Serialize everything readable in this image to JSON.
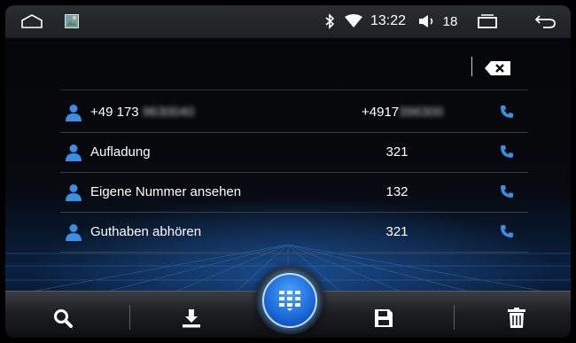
{
  "status_bar": {
    "home_icon": "home-outline-icon",
    "app_icon": "gallery-app-icon",
    "bluetooth_icon": "bluetooth-icon",
    "wifi_icon": "wifi-icon",
    "time": "13:22",
    "volume_icon": "volume-icon",
    "volume_level": "18",
    "recents_icon": "recent-apps-icon",
    "back_icon": "back-arrow-icon"
  },
  "dialer": {
    "input_value": "",
    "backspace_icon": "backspace-icon"
  },
  "contacts": [
    {
      "name": "+49 173 9630040",
      "number": "+4917396300",
      "name_blurred": true,
      "number_blurred": true
    },
    {
      "name": "Aufladung",
      "number": "321",
      "name_blurred": false,
      "number_blurred": false
    },
    {
      "name": "Eigene Nummer ansehen",
      "number": "132",
      "name_blurred": false,
      "number_blurred": false
    },
    {
      "name": "Guthaben abhören",
      "number": "321",
      "name_blurred": false,
      "number_blurred": false
    }
  ],
  "colors": {
    "accent": "#2e8bff",
    "icon_blue": "#3a8ee6",
    "divider": "#3a3c40"
  },
  "bottom_bar": {
    "search_icon": "search-icon",
    "download_icon": "download-icon",
    "dialpad_icon": "dialpad-icon",
    "save_icon": "save-icon",
    "delete_icon": "trash-icon"
  }
}
